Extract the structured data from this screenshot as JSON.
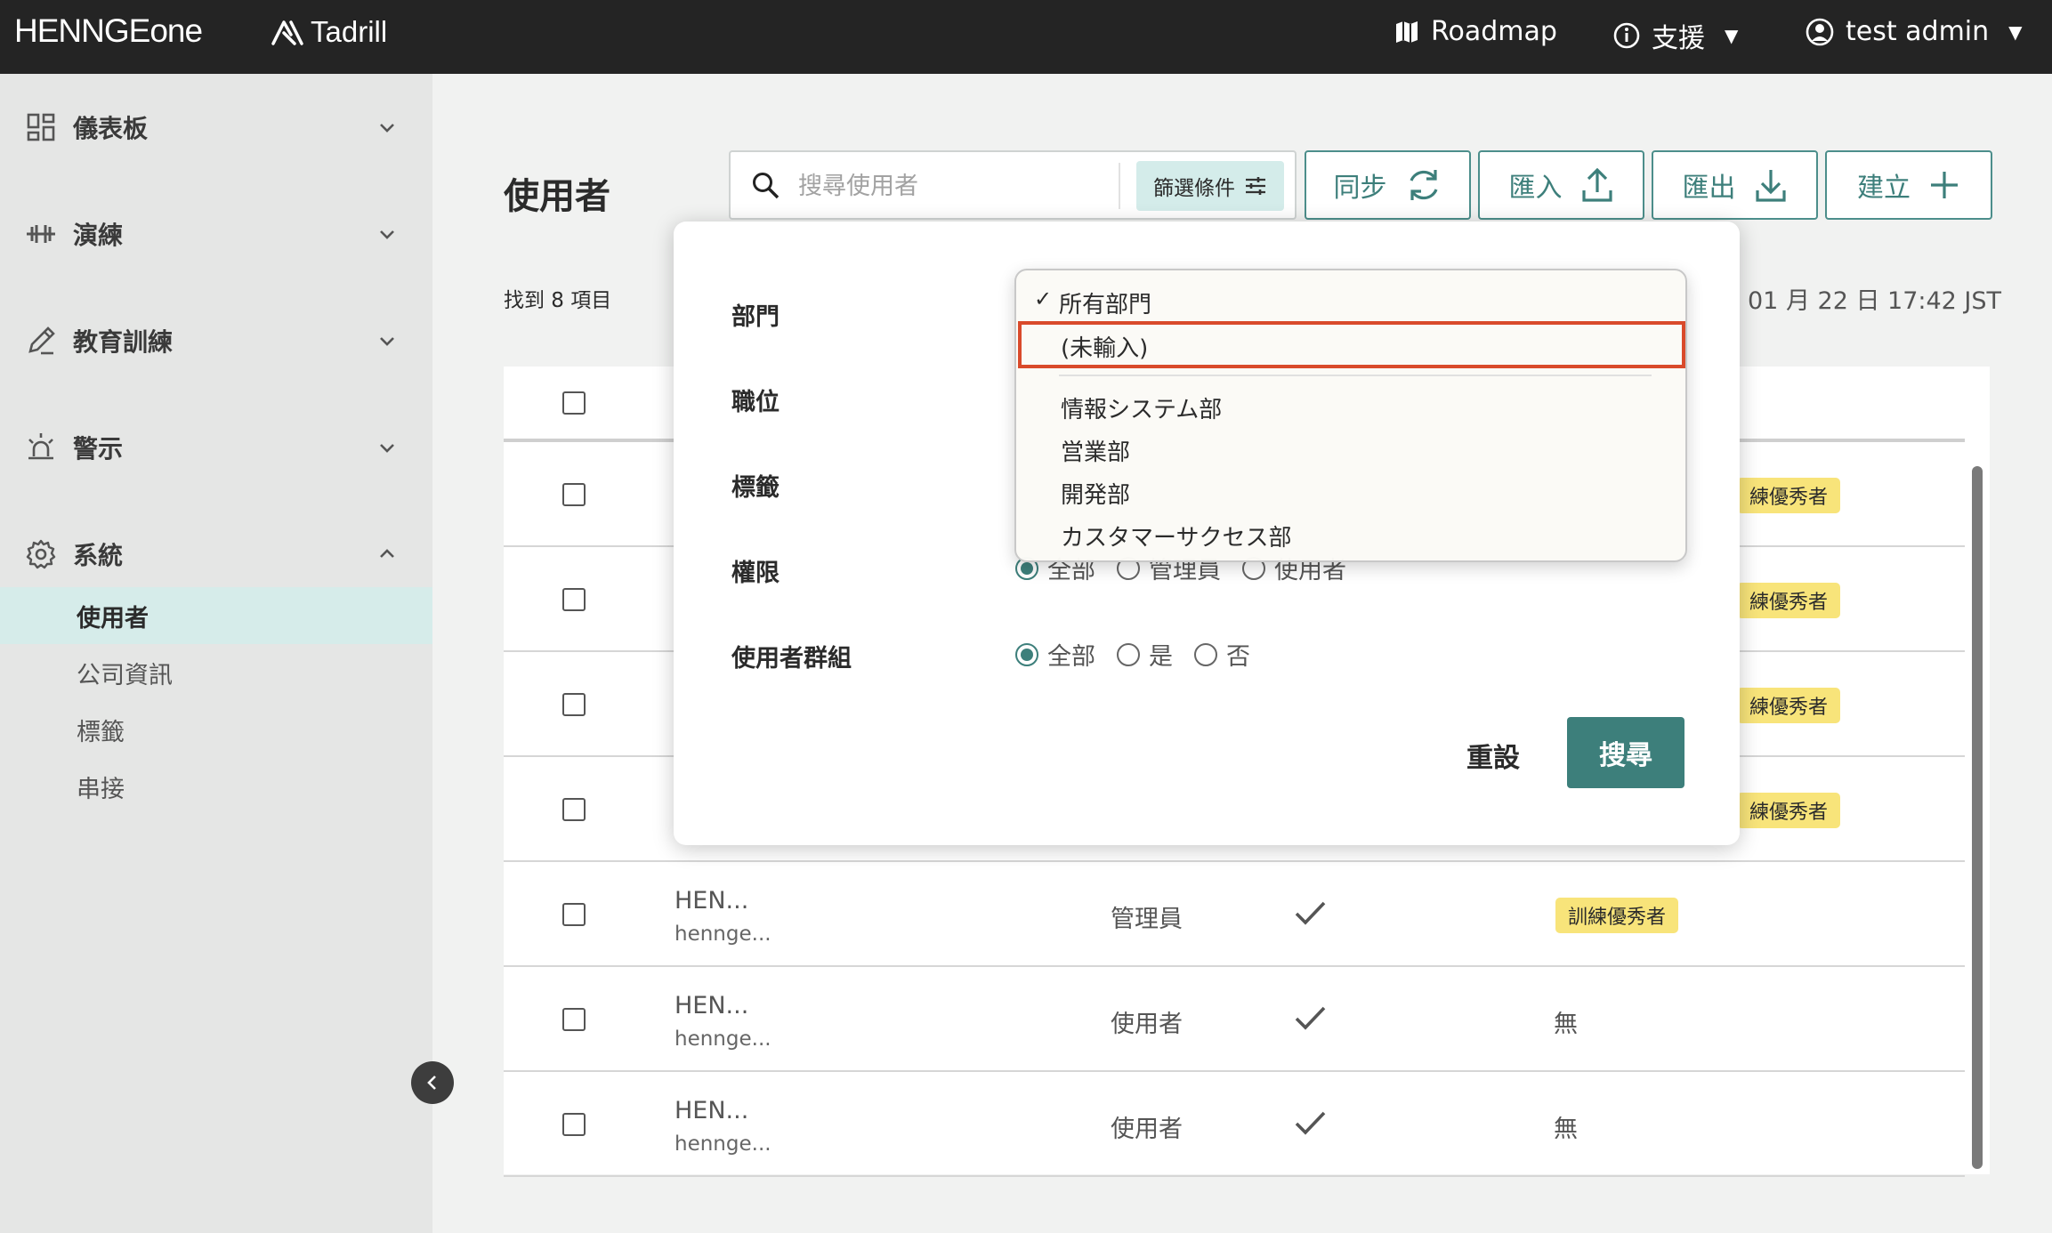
{
  "header": {
    "brand_henn": "HENNGE",
    "brand_one": "one",
    "product": "Tadrill",
    "roadmap": "Roadmap",
    "support": "支援",
    "user": "test admin",
    "bg_color": "#242424"
  },
  "sidebar": {
    "groups": [
      {
        "label": "儀表板",
        "icon": "dashboard-icon"
      },
      {
        "label": "演練",
        "icon": "dumbbell-icon"
      },
      {
        "label": "教育訓練",
        "icon": "pencil-icon"
      },
      {
        "label": "警示",
        "icon": "siren-icon"
      },
      {
        "label": "系統",
        "icon": "gear-icon"
      }
    ],
    "sub_items": [
      {
        "label": "使用者",
        "active": true
      },
      {
        "label": "公司資訊",
        "active": false
      },
      {
        "label": "標籤",
        "active": false
      },
      {
        "label": "串接",
        "active": false
      }
    ]
  },
  "main": {
    "title": "使用者",
    "search_placeholder": "搜尋使用者",
    "filter_label": "篩選條件",
    "actions": {
      "sync": "同步",
      "import": "匯入",
      "export": "匯出",
      "create": "建立"
    },
    "found": "找到 8 項目",
    "timestamp": "01 月 22 日 17:42 JST",
    "accent_color": "#3d7f7b"
  },
  "table": {
    "rows": [
      {
        "name": "",
        "email": "",
        "role": "",
        "verified": false,
        "badge": "練優秀者"
      },
      {
        "name": "",
        "email": "",
        "role": "",
        "verified": false,
        "badge": "練優秀者"
      },
      {
        "name": "",
        "email": "",
        "role": "",
        "verified": false,
        "badge": "練優秀者"
      },
      {
        "name": "",
        "email": "",
        "role": "",
        "verified": false,
        "badge": "練優秀者"
      },
      {
        "name": "HEN...",
        "email": "hennge...",
        "role": "管理員",
        "verified": true,
        "badge": "訓練優秀者"
      },
      {
        "name": "HEN...",
        "email": "hennge...",
        "role": "使用者",
        "verified": true,
        "badge": "無"
      },
      {
        "name": "HEN...",
        "email": "hennge...",
        "role": "使用者",
        "verified": true,
        "badge": "無"
      }
    ]
  },
  "filter_popover": {
    "labels": {
      "department": "部門",
      "position": "職位",
      "tags": "標籤",
      "permission": "權限",
      "user_group": "使用者群組"
    },
    "permission_options": [
      "全部",
      "管理員",
      "使用者"
    ],
    "permission_selected": "全部",
    "user_group_options": [
      "全部",
      "是",
      "否"
    ],
    "user_group_selected": "全部",
    "reset": "重設",
    "search": "搜尋"
  },
  "department_dropdown": {
    "check_mark": "✓",
    "options": [
      "所有部門",
      "(未輸入)",
      "情報システム部",
      "営業部",
      "開発部",
      "カスタマーサクセス部"
    ],
    "selected": "所有部門",
    "highlighted": "(未輸入)",
    "highlight_color": "#d94a2b"
  }
}
